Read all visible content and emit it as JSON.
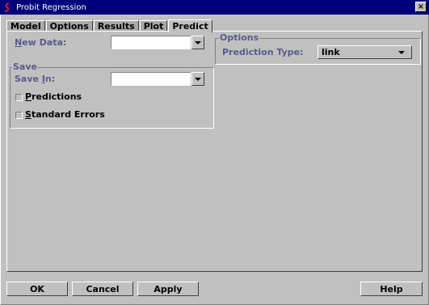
{
  "window": {
    "title": "Probit Regression",
    "close_glyph": "×"
  },
  "tabs": [
    {
      "label": "Model",
      "active": false
    },
    {
      "label": "Options",
      "active": false
    },
    {
      "label": "Results",
      "active": false
    },
    {
      "label": "Plot",
      "active": false
    },
    {
      "label": "Predict",
      "active": true
    }
  ],
  "predict": {
    "new_data": {
      "label_first": "N",
      "label_rest": "ew Data:",
      "value": ""
    },
    "save_group": {
      "title": "Save",
      "save_in": {
        "label_first": "Save ",
        "label_underlined": "I",
        "label_rest": "n:",
        "value": ""
      },
      "predictions": {
        "label_first": "P",
        "label_rest": "redictions",
        "checked": false
      },
      "standard_errors": {
        "label_first": "S",
        "label_rest": "tandard Errors",
        "checked": false
      }
    },
    "options_group": {
      "title": "Options",
      "prediction_type": {
        "label": "Prediction Type:",
        "value": "link"
      }
    }
  },
  "buttons": {
    "ok": "OK",
    "cancel": "Cancel",
    "apply": "Apply",
    "help": "Help"
  },
  "colors": {
    "titlebar": "#00007b",
    "label": "#5a5a8e",
    "face": "#c0c0c0"
  }
}
